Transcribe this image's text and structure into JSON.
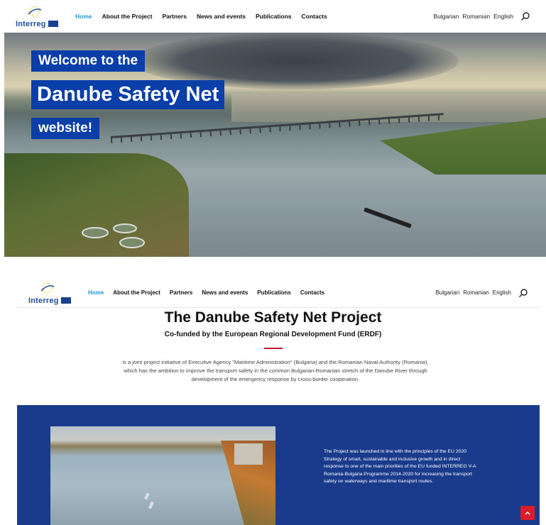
{
  "logo": {
    "text": "Interreg"
  },
  "nav": {
    "items": [
      "Home",
      "About the Project",
      "Partners",
      "News and events",
      "Publications",
      "Contacts"
    ],
    "active": "Home"
  },
  "languages": [
    "Bulgarian",
    "Romanian",
    "English"
  ],
  "hero": {
    "line1": "Welcome to the",
    "line2": "Danube Safety Net",
    "line3": "website!"
  },
  "intro": {
    "title": "The Danube Safety Net Project",
    "subtitle": "Co-funded by the European Regional Development Fund (ERDF)",
    "text": "is a joint project initiative of Executive Agency \"Maritime Administration\" (Bulgaria) and the Romanian Naval Authority (Romania), which has the ambition to improve the transport safety in the common Bulgarian-Romanian stretch of the Danube River through development of the emergency response by cross-border cooperation."
  },
  "band": {
    "text": "The Project was launched in line with the principles of the EU 2020 Strategy of smart, sustainable and inclusive growth and in direct response to one of the main priorities of the EU funded INTERREG V-A Romania-Bulgaria Programme 2014-2020 for increasing the transport safety on waterways and maritime transport routes."
  },
  "colors": {
    "accent": "#1e9bd7",
    "band": "#1a3b8c",
    "hero_label": "#0a3ea8",
    "rule": "#c0152f",
    "to_top": "#d81e2a"
  },
  "icons": {
    "search": "search-icon",
    "to_top": "chevron-up-icon",
    "logo": "interreg-logo"
  }
}
